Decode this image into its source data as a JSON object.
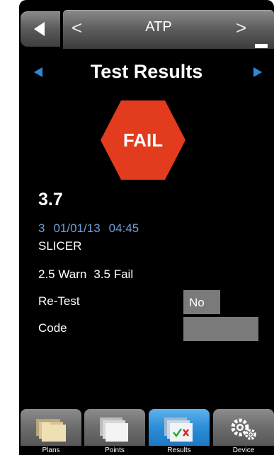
{
  "header": {
    "module_title": "ATP",
    "prev_glyph": "<",
    "next_glyph": ">"
  },
  "page": {
    "title": "Test Results"
  },
  "result": {
    "status": "FAIL",
    "status_color": "#e23b1d",
    "value": "3.7",
    "test_number": "3",
    "date": "01/01/13",
    "time": "04:45",
    "test_point": "SLICER",
    "warn_limit": "2.5 Warn",
    "fail_limit": "3.5 Fail"
  },
  "fields": {
    "retest_label": "Re-Test",
    "retest_value": "No",
    "code_label": "Code",
    "code_value": ""
  },
  "tabs": [
    {
      "label": "Plans",
      "icon": "folders-icon",
      "active": false
    },
    {
      "label": "Points",
      "icon": "pages-icon",
      "active": false
    },
    {
      "label": "Results",
      "icon": "results-check-icon",
      "active": true
    },
    {
      "label": "Device",
      "icon": "gears-icon",
      "active": false
    }
  ],
  "colors": {
    "accent_blue": "#2f88d8",
    "meta_blue": "#6f9fd6",
    "field_gray": "#7a7a7a"
  }
}
